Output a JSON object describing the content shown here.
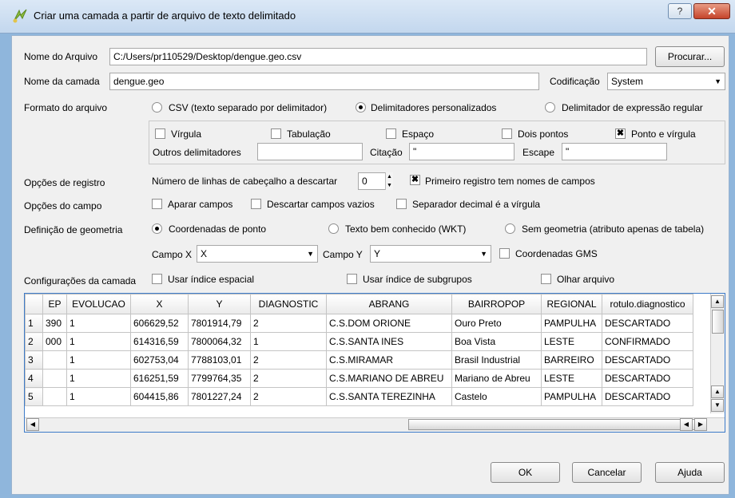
{
  "window": {
    "title": "Criar uma camada a partir de arquivo de texto delimitado",
    "help_label": "?",
    "close_label": "✕"
  },
  "file": {
    "label": "Nome do Arquivo",
    "value": "C:/Users/pr110529/Desktop/dengue.geo.csv",
    "browse_label": "Procurar..."
  },
  "layer": {
    "label": "Nome da camada",
    "value": "dengue.geo",
    "encoding_label": "Codificação",
    "encoding_value": "System"
  },
  "format": {
    "label": "Formato do arquivo",
    "options": [
      "CSV (texto separado por delimitador)",
      "Delimitadores personalizados",
      "Delimitador de expressão regular"
    ],
    "selected": 1
  },
  "delimiters": {
    "virgula": "Vírgula",
    "tabulacao": "Tabulação",
    "espaco": "Espaço",
    "dois_pontos": "Dois pontos",
    "ponto_virgula": "Ponto e vírgula",
    "outros_label": "Outros delimitadores",
    "outros_value": "",
    "citacao_label": "Citação",
    "citacao_value": "\"",
    "escape_label": "Escape",
    "escape_value": "\""
  },
  "record": {
    "label": "Opções de registro",
    "header_lines_label": "Número de linhas de cabeçalho a descartar",
    "header_lines_value": "0",
    "first_record_label": "Primeiro registro tem nomes de campos"
  },
  "field": {
    "label": "Opções do campo",
    "trim": "Aparar campos",
    "discard_empty": "Descartar campos vazios",
    "decimal_comma": "Separador decimal é a vírgula"
  },
  "geometry": {
    "label": "Definição de geometria",
    "options": [
      "Coordenadas de ponto",
      "Texto bem conhecido (WKT)",
      "Sem geometria (atributo apenas de tabela)"
    ],
    "selected": 0,
    "x_label": "Campo X",
    "x_value": "X",
    "y_label": "Campo Y",
    "y_value": "Y",
    "gms_label": "Coordenadas GMS"
  },
  "layer_settings": {
    "label": "Configurações da camada",
    "spatial_index": "Usar índice espacial",
    "subset_index": "Usar índice de subgrupos",
    "watch_file": "Olhar arquivo"
  },
  "table": {
    "columns": [
      "EP",
      "EVOLUCAO",
      "X",
      "Y",
      "DIAGNOSTIC",
      "ABRANG",
      "BAIRROPOP",
      "REGIONAL",
      "rotulo.diagnostico"
    ],
    "rows": [
      {
        "n": "1",
        "cells": [
          "390",
          "1",
          "606629,52",
          "7801914,79",
          "2",
          "C.S.DOM ORIONE",
          "Ouro Preto",
          "PAMPULHA",
          "DESCARTADO"
        ]
      },
      {
        "n": "2",
        "cells": [
          "000",
          "1",
          "614316,59",
          "7800064,32",
          "1",
          "C.S.SANTA INES",
          "Boa Vista",
          "LESTE",
          "CONFIRMADO"
        ]
      },
      {
        "n": "3",
        "cells": [
          "",
          "1",
          "602753,04",
          "7788103,01",
          "2",
          "C.S.MIRAMAR",
          "Brasil Industrial",
          "BARREIRO",
          "DESCARTADO"
        ]
      },
      {
        "n": "4",
        "cells": [
          "",
          "1",
          "616251,59",
          "7799764,35",
          "2",
          "C.S.MARIANO DE ABREU",
          "Mariano de Abreu",
          "LESTE",
          "DESCARTADO"
        ]
      },
      {
        "n": "5",
        "cells": [
          "",
          "1",
          "604415,86",
          "7801227,24",
          "2",
          "C.S.SANTA TEREZINHA",
          "Castelo",
          "PAMPULHA",
          "DESCARTADO"
        ]
      }
    ]
  },
  "buttons": {
    "ok": "OK",
    "cancel": "Cancelar",
    "help": "Ajuda"
  }
}
